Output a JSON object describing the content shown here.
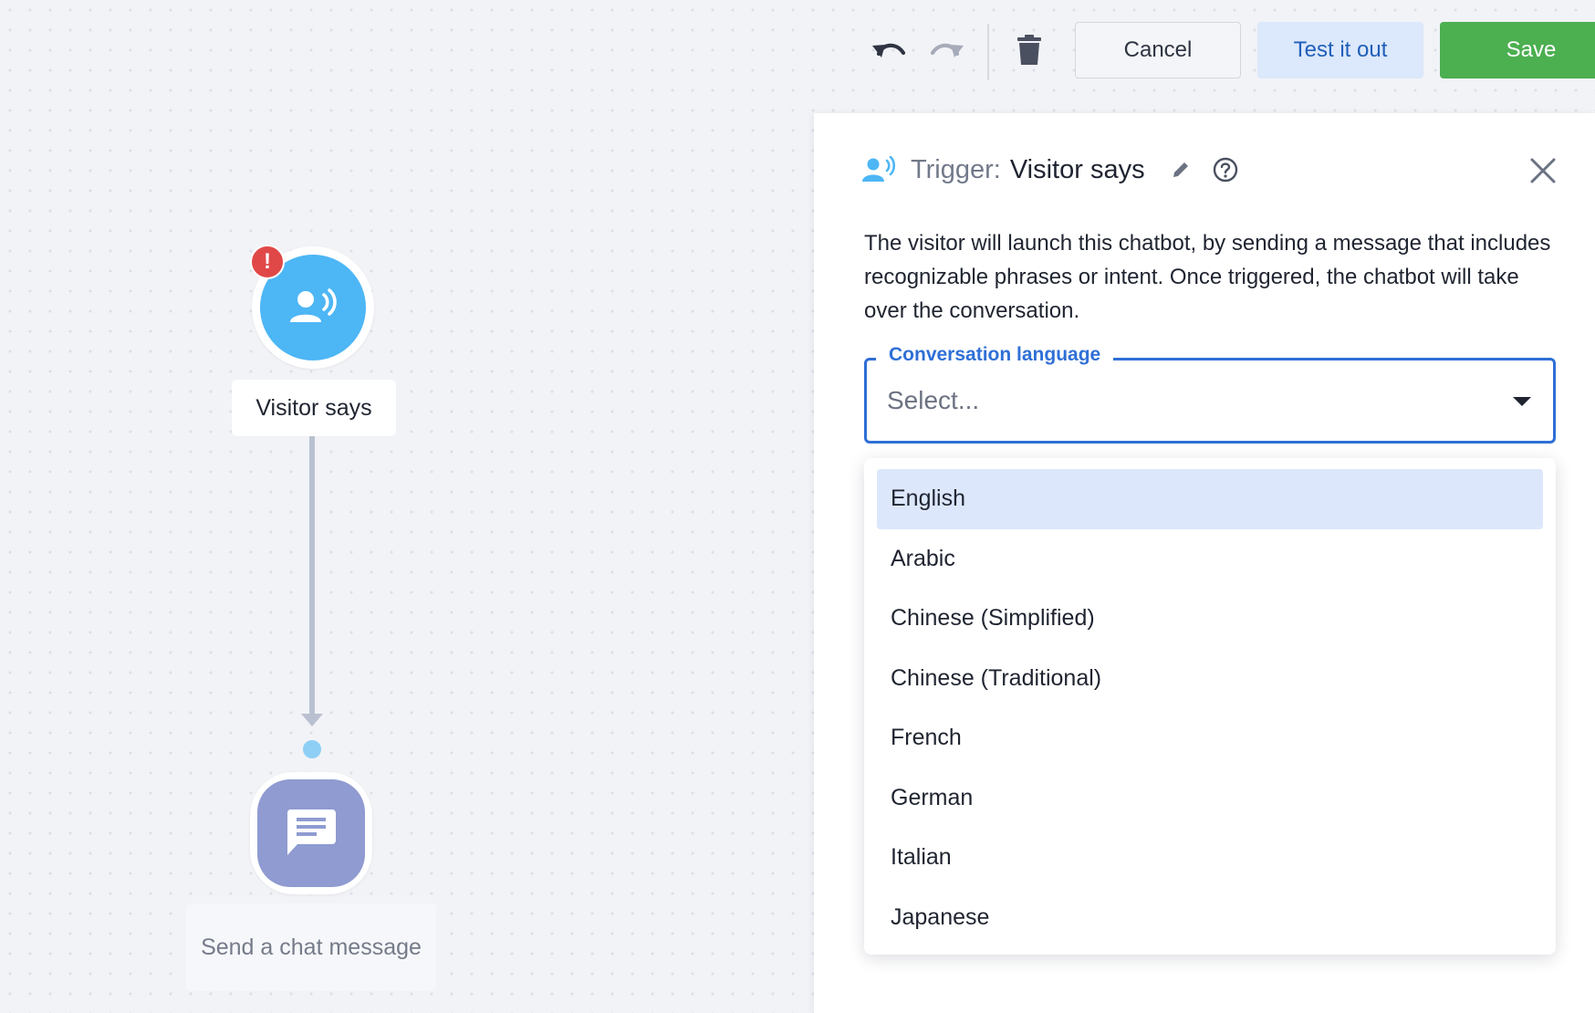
{
  "toolbar": {
    "undo_icon": "undo-icon",
    "redo_icon": "redo-icon",
    "delete_icon": "trash-icon",
    "cancel_label": "Cancel",
    "test_label": "Test it out",
    "save_label": "Save"
  },
  "canvas": {
    "trigger_node": {
      "label": "Visitor says",
      "icon": "visitor-speaking-icon",
      "alert": "!",
      "color": "#4db6f5"
    },
    "message_node": {
      "label": "Send a chat message",
      "icon": "chat-message-icon",
      "color": "#8f9bd1"
    }
  },
  "panel": {
    "trigger_prefix": "Trigger:",
    "trigger_name": "Visitor says",
    "description": "The visitor will launch this chatbot, by sending a message that includes recognizable phrases or intent. Once triggered, the chatbot will take over the conversation.",
    "language_select": {
      "label": "Conversation language",
      "placeholder": "Select...",
      "options": [
        "English",
        "Arabic",
        "Chinese (Simplified)",
        "Chinese (Traditional)",
        "French",
        "German",
        "Italian",
        "Japanese"
      ],
      "highlighted": "English"
    }
  },
  "colors": {
    "accent_blue": "#2f6fd6",
    "save_green": "#4caf50",
    "alert_red": "#e04848"
  }
}
